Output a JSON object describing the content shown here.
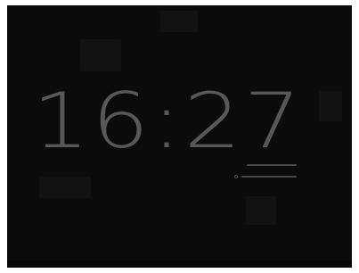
{
  "clock": {
    "time": "16:27"
  },
  "colors": {
    "background": "#0b0b0b",
    "clock_text": "#6e6e6e"
  },
  "icons": {
    "alarm": "alarm-icon"
  }
}
